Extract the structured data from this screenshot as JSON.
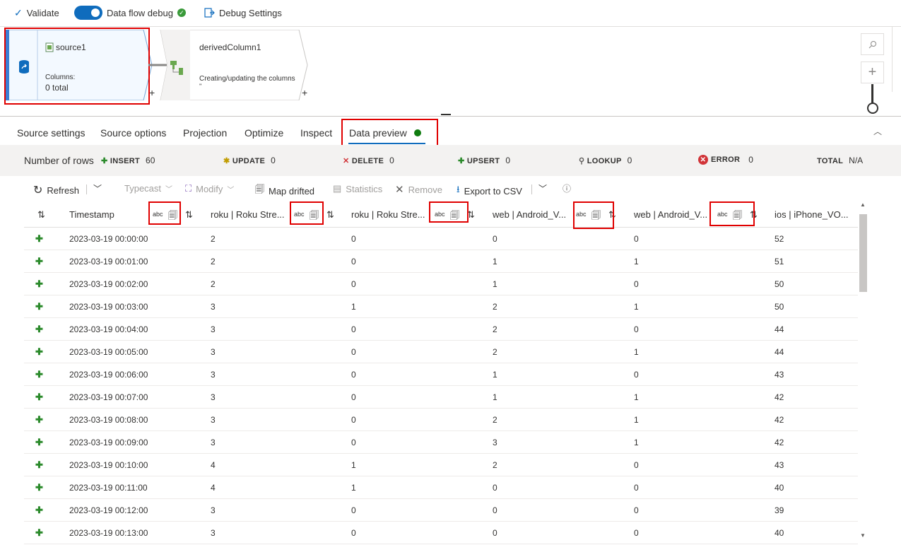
{
  "toolbar": {
    "validate_label": "Validate",
    "debug_label": "Data flow debug",
    "debug_settings_label": "Debug Settings"
  },
  "canvas": {
    "source_node": {
      "name": "source1",
      "columns_label": "Columns:",
      "columns_value": "0 total"
    },
    "derived_node": {
      "name": "derivedColumn1",
      "description": "Creating/updating the columns",
      "ellipsis": "''"
    },
    "plus_symbol": "+"
  },
  "tabs": [
    "Source settings",
    "Source options",
    "Projection",
    "Optimize",
    "Inspect",
    "Data preview"
  ],
  "stats": {
    "rows_label": "Number of rows",
    "insert": {
      "label": "INSERT",
      "value": "60"
    },
    "update": {
      "label": "UPDATE",
      "value": "0"
    },
    "delete": {
      "label": "DELETE",
      "value": "0"
    },
    "upsert": {
      "label": "UPSERT",
      "value": "0"
    },
    "lookup": {
      "label": "LOOKUP",
      "value": "0"
    },
    "error": {
      "label": "ERROR",
      "value": "0"
    },
    "total": {
      "label": "TOTAL",
      "value": "N/A"
    }
  },
  "actions": {
    "refresh": "Refresh",
    "typecast": "Typecast",
    "modify": "Modify",
    "map_drifted": "Map drifted",
    "statistics": "Statistics",
    "remove": "Remove",
    "export_csv": "Export to CSV"
  },
  "grid": {
    "type_badge": "abc",
    "columns": [
      "Timestamp",
      "roku | Roku Stre...",
      "roku | Roku Stre...",
      "web | Android_V...",
      "web | Android_V...",
      "ios | iPhone_VO..."
    ],
    "rows": [
      [
        "2023-03-19 00:00:00",
        "2",
        "0",
        "0",
        "0",
        "52"
      ],
      [
        "2023-03-19 00:01:00",
        "2",
        "0",
        "1",
        "1",
        "51"
      ],
      [
        "2023-03-19 00:02:00",
        "2",
        "0",
        "1",
        "0",
        "50"
      ],
      [
        "2023-03-19 00:03:00",
        "3",
        "1",
        "2",
        "1",
        "50"
      ],
      [
        "2023-03-19 00:04:00",
        "3",
        "0",
        "2",
        "0",
        "44"
      ],
      [
        "2023-03-19 00:05:00",
        "3",
        "0",
        "2",
        "1",
        "44"
      ],
      [
        "2023-03-19 00:06:00",
        "3",
        "0",
        "1",
        "0",
        "43"
      ],
      [
        "2023-03-19 00:07:00",
        "3",
        "0",
        "1",
        "1",
        "42"
      ],
      [
        "2023-03-19 00:08:00",
        "3",
        "0",
        "2",
        "1",
        "42"
      ],
      [
        "2023-03-19 00:09:00",
        "3",
        "0",
        "3",
        "1",
        "42"
      ],
      [
        "2023-03-19 00:10:00",
        "4",
        "1",
        "2",
        "0",
        "43"
      ],
      [
        "2023-03-19 00:11:00",
        "4",
        "1",
        "0",
        "0",
        "40"
      ],
      [
        "2023-03-19 00:12:00",
        "3",
        "0",
        "0",
        "0",
        "39"
      ],
      [
        "2023-03-19 00:13:00",
        "3",
        "0",
        "0",
        "0",
        "40"
      ]
    ]
  },
  "colors": {
    "accent": "#0f6cbd",
    "highlight": "#e00000",
    "insert_green": "#2b8a2b",
    "error_red": "#d13438"
  }
}
